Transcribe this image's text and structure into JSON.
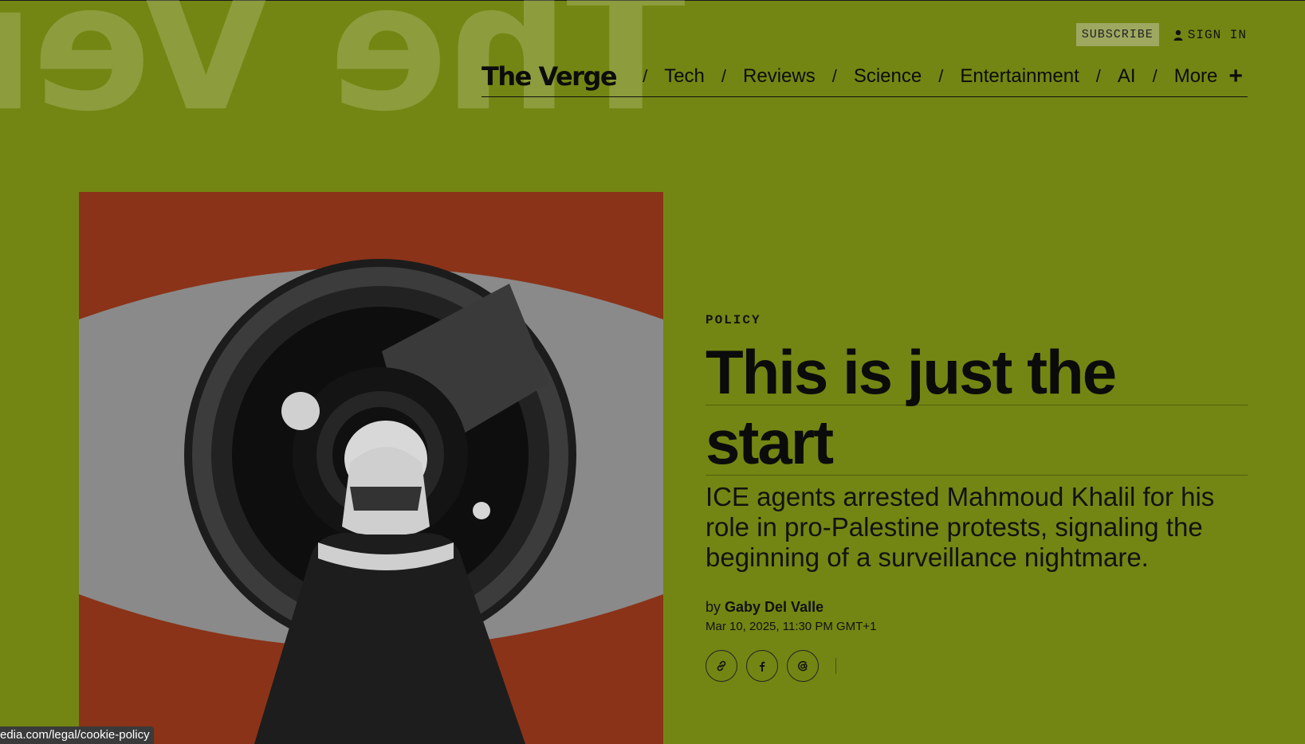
{
  "background_mark": "The Verge",
  "header": {
    "subscribe_label": "SUBSCRIBE",
    "signin_label": "SIGN IN",
    "logo_text": "The Verge",
    "nav_items": [
      "Tech",
      "Reviews",
      "Science",
      "Entertainment",
      "AI",
      "More"
    ],
    "nav_separator": "/"
  },
  "article": {
    "kicker": "POLICY",
    "headline_line1": "This is just the",
    "headline_line2": "start",
    "dek": "ICE agents arrested Mahmoud Khalil for his role in pro-Palestine protests, signaling the beginning of a surveillance nightmare.",
    "by_prefix": "by",
    "author": "Gaby Del Valle",
    "date": "Mar 10, 2025, 11:30 PM GMT+1"
  },
  "share": {
    "icons": [
      "link-icon",
      "facebook-icon",
      "threads-icon"
    ]
  },
  "statusbar": {
    "url": "edia.com/legal/cookie-policy"
  },
  "colors": {
    "background": "#738613",
    "hero_red": "#8a3318",
    "text": "#111111"
  }
}
